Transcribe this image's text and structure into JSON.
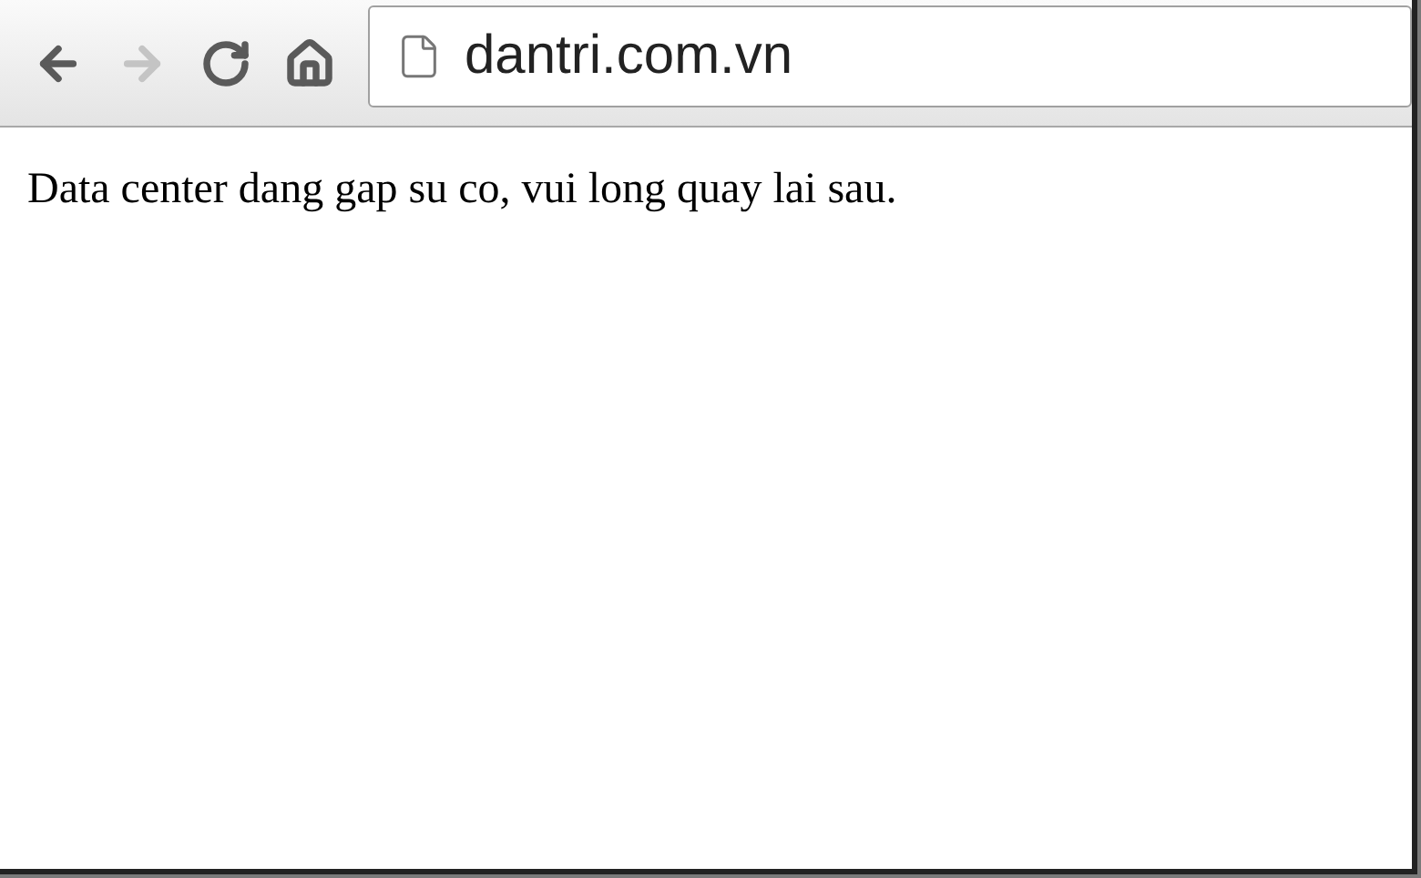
{
  "toolbar": {
    "buttons": [
      {
        "kind": "back",
        "disabled": false
      },
      {
        "kind": "forward",
        "disabled": true
      },
      {
        "kind": "reload",
        "disabled": false
      },
      {
        "kind": "home",
        "disabled": false
      }
    ],
    "address": {
      "value": "dantri.com.vn"
    }
  },
  "page": {
    "message": "Data center dang gap su co, vui long quay lai sau."
  }
}
